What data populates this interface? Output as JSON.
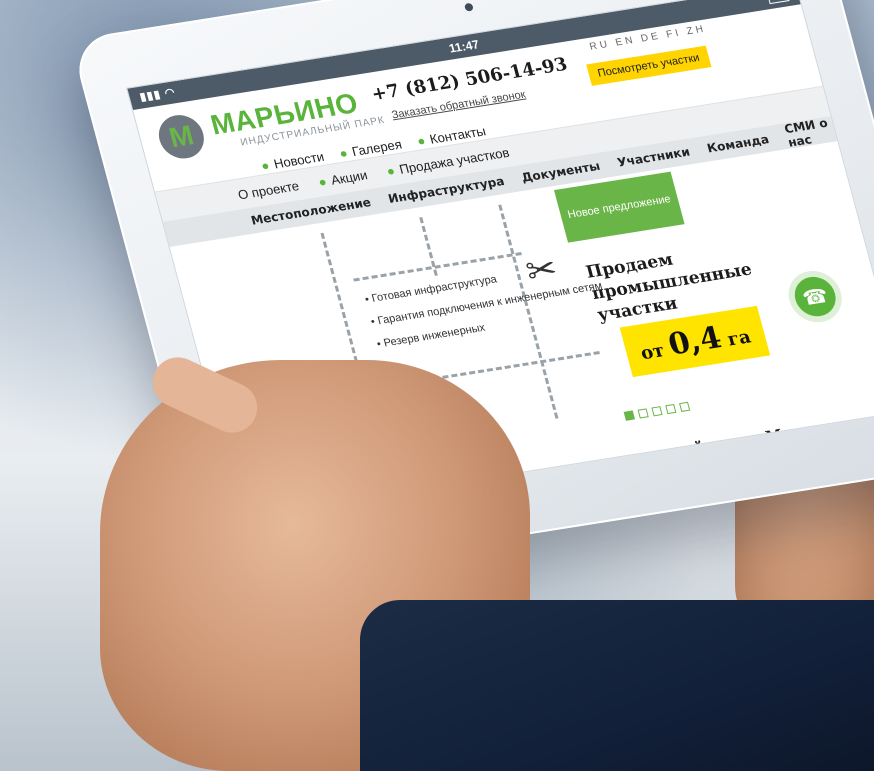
{
  "statusbar": {
    "time": "11:47"
  },
  "header": {
    "logo_letter": "М",
    "logo_name": "МАРЬИНО",
    "logo_subtitle": "ИНДУСТРИАЛЬНЫЙ ПАРК",
    "phone": "+7 (812) 506-14-93",
    "callback_link": "Заказать обратный звонок",
    "languages": "RU EN DE FI ZH",
    "view_plots_button": "Посмотреть участки"
  },
  "top_nav": [
    "Новости",
    "Галерея",
    "Контакты"
  ],
  "main_nav": [
    "О проекте",
    "Акции",
    "Продажа участков"
  ],
  "sub_nav": [
    "Местоположение",
    "Инфраструктура",
    "Документы",
    "Участники",
    "Команда",
    "СМИ о нас"
  ],
  "hero": {
    "benefits": [
      "• Готовая инфраструктура",
      "• Гарантия подключения к инженерным сетям",
      "• Резерв инженерных"
    ],
    "new_offer_badge": "Новое предложение",
    "offer_title": "Продаем промышленные участки",
    "price_prefix": "от",
    "price_value": "0,4",
    "price_unit": "га",
    "slide_count": 5,
    "active_slide": 1
  },
  "footer_title": "альный парк «Марьино»",
  "colors": {
    "brand_green": "#5ab43c",
    "accent_yellow": "#ffe400"
  },
  "icons": [
    "signal-icon",
    "wifi-icon",
    "battery-icon",
    "scissors-icon",
    "phone-icon"
  ]
}
